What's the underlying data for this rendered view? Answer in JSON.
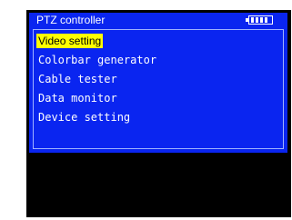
{
  "header": {
    "title": "PTZ controller",
    "battery_icon": "battery-full-icon"
  },
  "menu": {
    "items": [
      {
        "label": "Video setting",
        "selected": true
      },
      {
        "label": "Colorbar generator",
        "selected": false
      },
      {
        "label": "Cable tester",
        "selected": false
      },
      {
        "label": "Data monitor",
        "selected": false
      },
      {
        "label": "Device setting",
        "selected": false
      }
    ]
  },
  "colors": {
    "panel": "#0a25f0",
    "highlight": "#ffff00",
    "background": "#000000",
    "text": "#ffffff"
  }
}
